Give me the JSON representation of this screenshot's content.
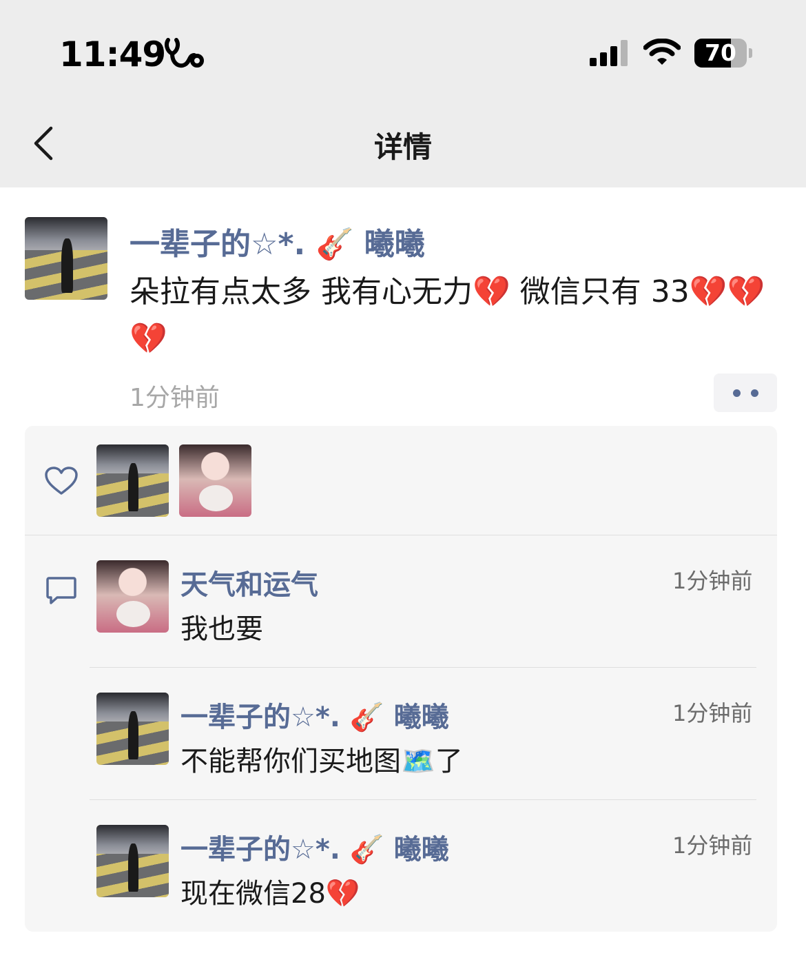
{
  "status_bar": {
    "time": "11:49",
    "battery": "70",
    "battery_level": 0.7
  },
  "nav": {
    "title": "详情",
    "back_icon": "chevron-left-icon"
  },
  "post": {
    "author": "一辈子的☆*. 🎸 曦曦",
    "text": "朵拉有点太多 我有心无力💔 微信只有 33💔💔💔",
    "time": "1分钟前"
  },
  "likes": {
    "icon": "heart-outline-icon",
    "avatars": [
      "street-photo-avatar",
      "girl-plush-avatar"
    ]
  },
  "comments": [
    {
      "name": "天气和运气",
      "text": "我也要",
      "time": "1分钟前",
      "avatar": "girl-plush-avatar"
    },
    {
      "name": "一辈子的☆*. 🎸 曦曦",
      "text": "不能帮你们买地图🗺️了",
      "time": "1分钟前",
      "avatar": "street-photo-avatar"
    },
    {
      "name": "一辈子的☆*. 🎸 曦曦",
      "text": "现在微信28💔",
      "time": "1分钟前",
      "avatar": "street-photo-avatar"
    }
  ],
  "colors": {
    "link_name": "#576b95",
    "header_bg": "#ededed",
    "panel_bg": "#f6f6f6"
  }
}
